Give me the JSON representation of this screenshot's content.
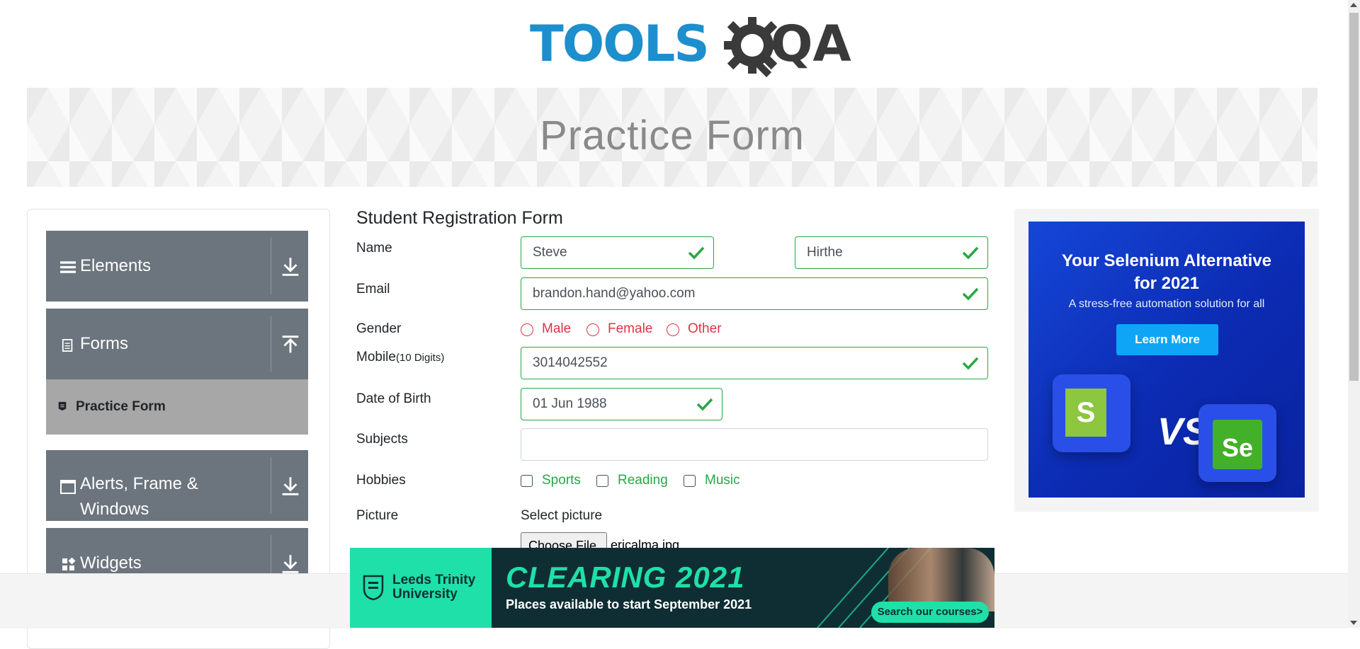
{
  "logo": {
    "tools": "TOOLS",
    "qa": "QA",
    "colors": {
      "tools": "#1d8fcc",
      "qa": "#3a3a3a"
    }
  },
  "banner": {
    "title": "Practice Form"
  },
  "sidebar": {
    "groups": [
      {
        "label": "Elements",
        "icon": "menu-icon",
        "arrow": "download-icon"
      },
      {
        "label": "Forms",
        "icon": "document-icon",
        "arrow": "upload-icon"
      },
      {
        "label": "Alerts, Frame &",
        "label2": "Windows",
        "icon": "window-icon",
        "arrow": "download-icon"
      },
      {
        "label": "Widgets",
        "icon": "widgets-icon",
        "arrow": "download-icon"
      }
    ],
    "active_item": {
      "label": "Practice Form",
      "icon": "form-icon"
    }
  },
  "form": {
    "title": "Student Registration Form",
    "labels": {
      "name": "Name",
      "email": "Email",
      "gender": "Gender",
      "mobile": "Mobile",
      "mobile_hint": "(10 Digits)",
      "dob": "Date of Birth",
      "subjects": "Subjects",
      "hobbies": "Hobbies",
      "picture": "Picture"
    },
    "first_name": "Steve",
    "last_name": "Hirthe",
    "email": "brandon.hand@yahoo.com",
    "gender_options": [
      "Male",
      "Female",
      "Other"
    ],
    "mobile": "3014042552",
    "dob": "01 Jun 1988",
    "subjects": "",
    "hobbies": [
      "Sports",
      "Reading",
      "Music"
    ],
    "picture_label": "Select picture",
    "choose_file": "Choose File",
    "file_name": "ericalma.jpg",
    "colors": {
      "valid": "#28a745",
      "invalid": "#dc3545"
    }
  },
  "ad_right": {
    "headline": "Your Selenium Alternative for 2021",
    "sub": "A stress-free automation solution for all",
    "button": "Learn More",
    "vs": "VS",
    "tile_left": "S",
    "tile_right": "Se"
  },
  "ad_bottom": {
    "university": "Leeds Trinity",
    "university2": "University",
    "headline": "CLEARING 2021",
    "sub": "Places available to start September 2021",
    "cta": "Search our courses>"
  }
}
